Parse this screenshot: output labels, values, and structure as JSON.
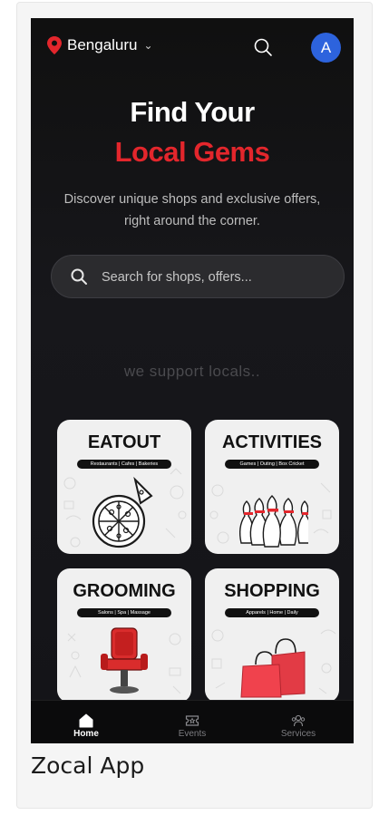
{
  "header": {
    "location": "Bengaluru",
    "avatar_initial": "A"
  },
  "hero": {
    "line1": "Find Your",
    "line2": "Local Gems",
    "subtitle": "Discover unique shops and exclusive offers, right around the corner."
  },
  "search": {
    "placeholder": "Search for shops, offers..."
  },
  "tagline": "we support locals..",
  "categories": [
    {
      "title": "EATOUT",
      "subtitle": "Restaurants | Cafes | Bakeries"
    },
    {
      "title": "ACTIVITIES",
      "subtitle": "Games | Outing | Box Cricket"
    },
    {
      "title": "GROOMING",
      "subtitle": "Salons | Spa | Massage"
    },
    {
      "title": "SHOPPING",
      "subtitle": "Apparels | Home | Daily"
    }
  ],
  "nav": [
    {
      "label": "Home",
      "icon": "home-icon",
      "active": true
    },
    {
      "label": "Events",
      "icon": "ticket-icon",
      "active": false
    },
    {
      "label": "Services",
      "icon": "users-icon",
      "active": false
    }
  ],
  "caption": "Zocal App",
  "colors": {
    "accent_red": "#e3262c",
    "avatar_blue": "#2d63dd",
    "background": "#121214"
  }
}
